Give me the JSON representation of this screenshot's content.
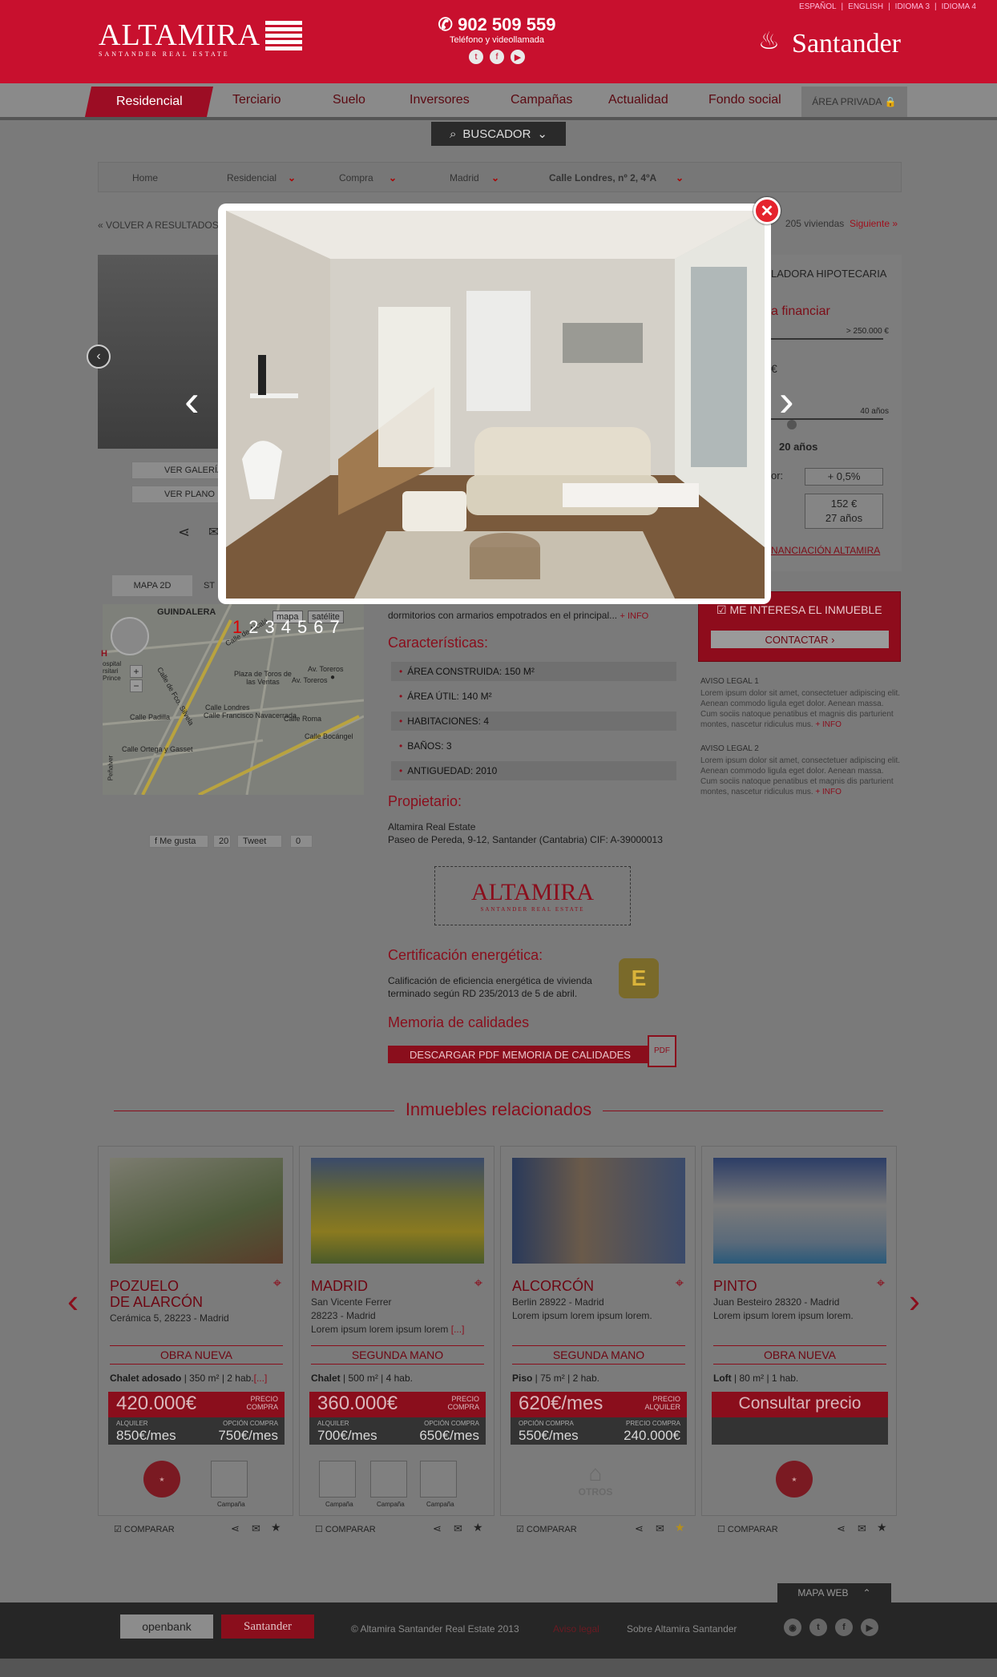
{
  "header": {
    "languages": [
      "ESPAÑOL",
      "|",
      "ENGLISH",
      "|",
      "IDIOMA 3",
      "|",
      "IDIOMA 4"
    ],
    "logo_text": "ALTAMIRA",
    "logo_sub": "SANTANDER REAL ESTATE",
    "phone": "902 509 559",
    "phone_sub": "Teléfono y videollamada",
    "brand": "Santander"
  },
  "nav": {
    "items": [
      "Residencial",
      "Terciario",
      "Suelo",
      "Inversores",
      "Campañas",
      "Actualidad",
      "Fondo social"
    ],
    "private": "ÁREA PRIVADA"
  },
  "search": {
    "label": "BUSCADOR"
  },
  "breadcrumb": [
    "Home",
    "Residencial",
    "Compra",
    "Madrid",
    "Calle Londres, nº 2, 4ºA"
  ],
  "back_link": "« VOLVER A RESULTADOS",
  "pager": {
    "count": "205 viviendas",
    "next": "Siguiente »"
  },
  "gallery": {
    "view_gallery": "VER GALERÍA",
    "view_plan": "VER PLANO",
    "dots": [
      "1",
      "2",
      "3",
      "4",
      "5",
      "6",
      "7"
    ]
  },
  "map": {
    "tab1": "MAPA 2D",
    "tab2": "ST",
    "map_btn": "mapa",
    "sat_btn": "satélite",
    "streets": [
      "GUINDALERA",
      "Calle de Alcalá",
      "Av. Toreros",
      "Plaza de Toros de las Ventas",
      "Calle Londres",
      "Calle Francisco Navacerrada",
      "Calle Roma",
      "Calle Padilla",
      "Calle Ortega y Gasset",
      "Calle de Fco. Silvela",
      "Peñalver"
    ]
  },
  "social": {
    "like": "Me gusta",
    "like_count": "20",
    "tweet": "Tweet",
    "tweet_count": "0"
  },
  "simulator": {
    "title": "LADORA HIPOTECARIA",
    "subtitle": "a financiar",
    "max": "> 250.000 €",
    "years_max": "40 años",
    "years": "20 años",
    "rate_label": "or:",
    "rate": "+ 0,5%",
    "fee": "152 €",
    "fee_years": "27 años",
    "link": "NANCIACIÓN ALTAMIRA",
    "currency": "€"
  },
  "interest": {
    "checkbox": "ME INTERESA EL INMUEBLE",
    "contact": "CONTACTAR"
  },
  "legal": [
    {
      "title": "AVISO LEGAL 1",
      "body": "Lorem ipsum dolor sit amet, consectetuer adipiscing elit. Aenean commodo ligula eget dolor. Aenean massa. Cum sociis natoque penatibus et magnis dis parturient montes, nascetur ridiculus mus.",
      "more": "+ INFO"
    },
    {
      "title": "AVISO LEGAL 2",
      "body": "Lorem ipsum dolor sit amet, consectetuer adipiscing elit. Aenean commodo ligula eget dolor. Aenean massa. Cum sociis natoque penatibus et magnis dis parturient montes, nascetur ridiculus mus.",
      "more": "+ INFO"
    }
  ],
  "description": {
    "text": "dormitorios con armarios empotrados en el principal...",
    "more": "+ INFO"
  },
  "features": {
    "title": "Características:",
    "items": [
      "ÁREA CONSTRUIDA: 150 M²",
      "ÁREA ÚTIL: 140 M²",
      "HABITACIONES: 4",
      "BAÑOS: 3",
      "ANTIGUEDAD: 2010"
    ]
  },
  "owner": {
    "title": "Propietario:",
    "name": "Altamira Real Estate",
    "address": "Paseo de Pereda, 9-12, Santander (Cantabria) CIF: A-39000013"
  },
  "energy": {
    "title": "Certificación energética:",
    "text1": "Calificación de eficiencia energética de vivienda",
    "text2": "terminado según RD 235/2013 de 5 de abril.",
    "grade": "E"
  },
  "quality": {
    "title": "Memoria de calidades",
    "button": "DESCARGAR PDF MEMORIA DE CALIDADES"
  },
  "related": {
    "title": "Inmuebles relacionados",
    "cards": [
      {
        "city1": "POZUELO",
        "city2": "DE ALARCÓN",
        "addr": [
          "Cerámica 5, 28223 - Madrid"
        ],
        "type": "OBRA NUEVA",
        "detail": "Chalet adosado",
        "detail2": " | 350 m² | 2 hab.",
        "more": "[...]",
        "price": "420.000€",
        "price_lbl1": "PRECIO",
        "price_lbl2": "COMPRA",
        "c1": "ALQUILER",
        "v1": "850€/mes",
        "c2": "OPCIÓN COMPRA",
        "v2": "750€/mes",
        "compare": "COMPARAR",
        "campaign": "Campaña"
      },
      {
        "city1": "MADRID",
        "city2": "",
        "addr": [
          "San Vicente Ferrer",
          "28223 - Madrid",
          "Lorem ipsum lorem ipsum lorem"
        ],
        "addr_more": "[...]",
        "type": "SEGUNDA MANO",
        "detail": "Chalet",
        "detail2": " | 500 m² | 4 hab.",
        "price": "360.000€",
        "price_lbl1": "PRECIO",
        "price_lbl2": "COMPRA",
        "c1": "ALQUILER",
        "v1": "700€/mes",
        "c2": "OPCIÓN COMPRA",
        "v2": "650€/mes",
        "compare": "COMPARAR",
        "campaign": "Campaña"
      },
      {
        "city1": "ALCORCÓN",
        "city2": "",
        "addr": [
          "Berlin 28922 - Madrid",
          "Lorem ipsum lorem ipsum lorem."
        ],
        "type": "SEGUNDA MANO",
        "detail": "Piso",
        "detail2": " | 75 m² | 2 hab.",
        "price": "620€/mes",
        "price_lbl1": "PRECIO",
        "price_lbl2": "ALQUILER",
        "c1": "OPCIÓN COMPRA",
        "v1": "550€/mes",
        "c2": "PRECIO COMPRA",
        "v2": "240.000€",
        "compare": "COMPARAR",
        "otros": "OTROS"
      },
      {
        "city1": "PINTO",
        "city2": "",
        "addr": [
          "Juan Besteiro 28320 - Madrid",
          "Lorem ipsum lorem ipsum lorem."
        ],
        "type": "OBRA NUEVA",
        "detail": "Loft",
        "detail2": " | 80 m² | 1 hab.",
        "price": "Consultar precio",
        "compare": "COMPARAR"
      }
    ]
  },
  "footer": {
    "openbank": "openbank",
    "santander": "Santander",
    "copy": "© Altamira Santander Real Estate 2013",
    "legal": "Aviso legal",
    "about": "Sobre Altamira Santander",
    "mapweb": "MAPA WEB"
  }
}
